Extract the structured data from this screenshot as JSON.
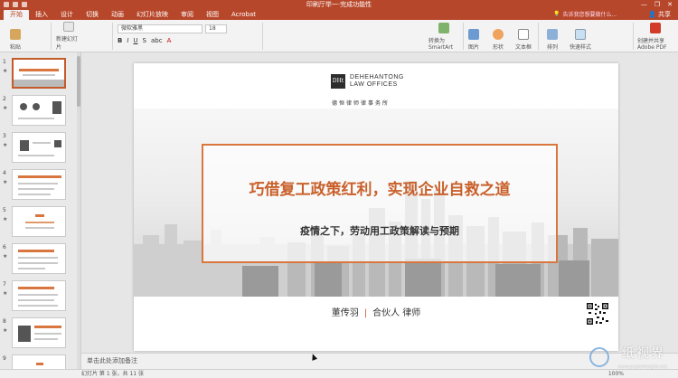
{
  "app": {
    "doc_title": "印刷厅举一·完成功能性",
    "tell_me": "告诉我您想要做什么...",
    "share": "共享"
  },
  "tabs": [
    "开始",
    "插入",
    "设计",
    "切换",
    "动画",
    "幻灯片放映",
    "审阅",
    "视图",
    "Acrobat"
  ],
  "ribbon": {
    "font_name": "微软雅黑",
    "font_size": "18",
    "groups": [
      "粘贴",
      "新建幻灯片",
      "转换为SmartArt",
      "图片",
      "形状",
      "文本框",
      "排列",
      "快速样式",
      "创建并共享Adobe PDF"
    ]
  },
  "thumbnails": {
    "numbers": [
      "1",
      "2",
      "3",
      "4",
      "5",
      "6",
      "7",
      "8",
      "9"
    ],
    "star": "★"
  },
  "slide": {
    "logo_box": "DHt",
    "firm_en_line1": "DEHEHANTONG",
    "firm_en_line2": "LAW OFFICES",
    "firm_cn": "德恒律师律事务所",
    "main_title": "巧借复工政策红利，实现企业自救之道",
    "sub_title": "疫情之下，劳动用工政策解读与预期",
    "presenter_name": "董传羽",
    "presenter_sep": "|",
    "presenter_role": "合伙人 律师"
  },
  "notes": {
    "placeholder": "单击此处添加备注"
  },
  "status": {
    "slide_info": "幻灯片 第 1 张，共 11 张",
    "zoom": "100%"
  },
  "watermark": {
    "text": "纸视界",
    "url": "www.paperinsight.net"
  },
  "colors": {
    "accent": "#b7472a",
    "title_orange": "#c9602a",
    "frame_orange": "#d9773e"
  }
}
